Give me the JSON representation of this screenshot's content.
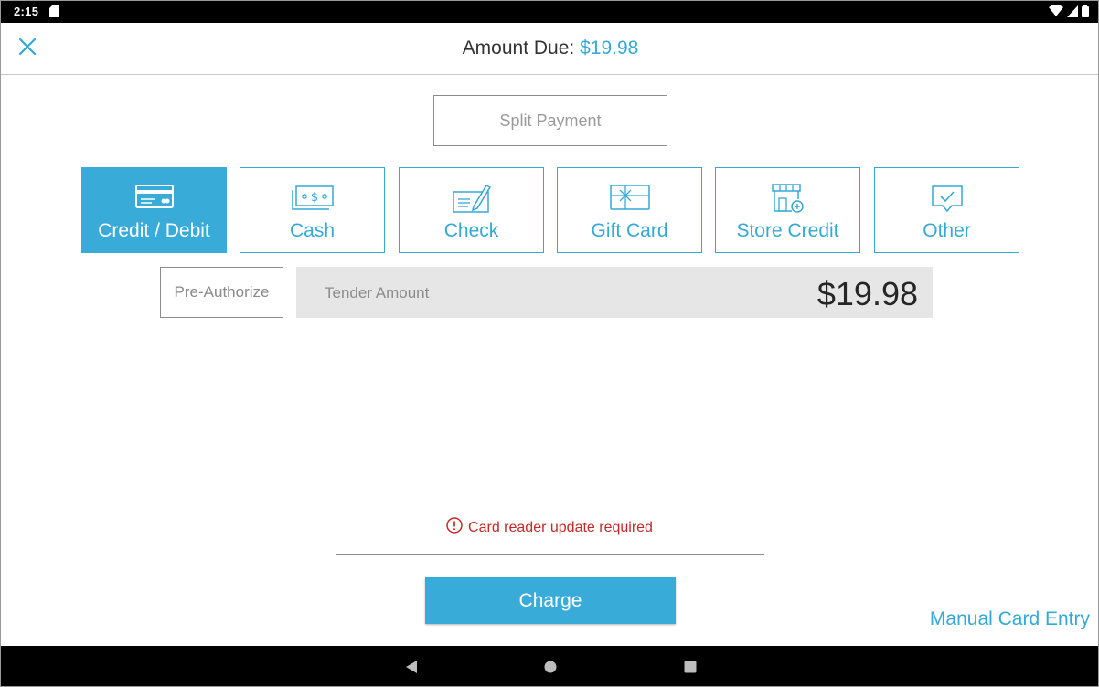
{
  "status_bar": {
    "time": "2:15",
    "icons": [
      "sd-card-icon",
      "wifi-icon",
      "signal-icon",
      "battery-icon"
    ]
  },
  "header": {
    "close_icon": "close-icon",
    "title_label": "Amount Due:",
    "title_amount": "$19.98"
  },
  "split_payment": {
    "label": "Split Payment"
  },
  "tender_types": [
    {
      "label": "Credit / Debit",
      "icon": "credit-card-icon",
      "selected": true
    },
    {
      "label": "Cash",
      "icon": "cash-icon",
      "selected": false
    },
    {
      "label": "Check",
      "icon": "check-icon",
      "selected": false
    },
    {
      "label": "Gift Card",
      "icon": "gift-card-icon",
      "selected": false
    },
    {
      "label": "Store Credit",
      "icon": "store-credit-icon",
      "selected": false
    },
    {
      "label": "Other",
      "icon": "other-icon",
      "selected": false
    }
  ],
  "pre_authorize": {
    "label": "Pre-Authorize"
  },
  "tender_amount": {
    "placeholder": "Tender Amount",
    "value": "$19.98"
  },
  "warning": {
    "text": "Card reader update required",
    "icon": "alert-circle-icon"
  },
  "charge": {
    "label": "Charge"
  },
  "manual_entry": {
    "label": "Manual Card Entry"
  },
  "colors": {
    "accent": "#39abd9",
    "warning": "#c62828",
    "tender_bg": "#e6e6e6"
  },
  "nav_bar": {
    "icons": [
      "back-icon",
      "home-icon",
      "recents-icon"
    ]
  }
}
